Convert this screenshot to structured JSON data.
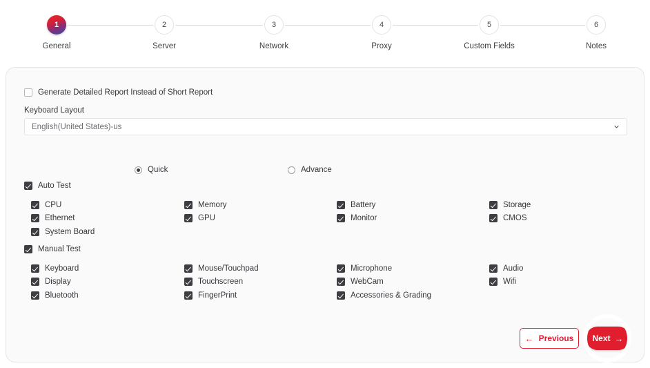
{
  "stepper": {
    "steps": [
      {
        "number": "1",
        "label": "General",
        "active": true
      },
      {
        "number": "2",
        "label": "Server",
        "active": false
      },
      {
        "number": "3",
        "label": "Network",
        "active": false
      },
      {
        "number": "4",
        "label": "Proxy",
        "active": false
      },
      {
        "number": "5",
        "label": "Custom Fields",
        "active": false
      },
      {
        "number": "6",
        "label": "Notes",
        "active": false
      }
    ]
  },
  "form": {
    "detailed_report": {
      "label": "Generate Detailed Report Instead of Short Report",
      "checked": false
    },
    "keyboard_layout": {
      "label": "Keyboard Layout",
      "value": "English(United States)-us"
    },
    "mode": {
      "options": [
        {
          "label": "Quick",
          "selected": true
        },
        {
          "label": "Advance",
          "selected": false
        }
      ]
    },
    "auto_test": {
      "label": "Auto Test",
      "checked": true,
      "columns": [
        [
          {
            "label": "CPU",
            "checked": true
          },
          {
            "label": "Ethernet",
            "checked": true
          },
          {
            "label": "System Board",
            "checked": true
          }
        ],
        [
          {
            "label": "Memory",
            "checked": true
          },
          {
            "label": "GPU",
            "checked": true
          }
        ],
        [
          {
            "label": "Battery",
            "checked": true
          },
          {
            "label": "Monitor",
            "checked": true
          }
        ],
        [
          {
            "label": "Storage",
            "checked": true
          },
          {
            "label": "CMOS",
            "checked": true
          }
        ]
      ]
    },
    "manual_test": {
      "label": "Manual Test",
      "checked": true,
      "columns": [
        [
          {
            "label": "Keyboard",
            "checked": true
          },
          {
            "label": "Display",
            "checked": true
          },
          {
            "label": "Bluetooth",
            "checked": true
          }
        ],
        [
          {
            "label": "Mouse/Touchpad",
            "checked": true
          },
          {
            "label": "Touchscreen",
            "checked": true
          },
          {
            "label": "FingerPrint",
            "checked": true
          }
        ],
        [
          {
            "label": "Microphone",
            "checked": true
          },
          {
            "label": "WebCam",
            "checked": true
          },
          {
            "label": "Accessories & Grading",
            "checked": true
          }
        ],
        [
          {
            "label": "Audio",
            "checked": true
          },
          {
            "label": "Wifi",
            "checked": true
          }
        ]
      ]
    }
  },
  "footer": {
    "previous_label": "Previous",
    "next_label": "Next"
  },
  "colors": {
    "accent_red": "#e01e2d",
    "page_bg": "#ffffff",
    "card_bg": "#fafafa"
  }
}
